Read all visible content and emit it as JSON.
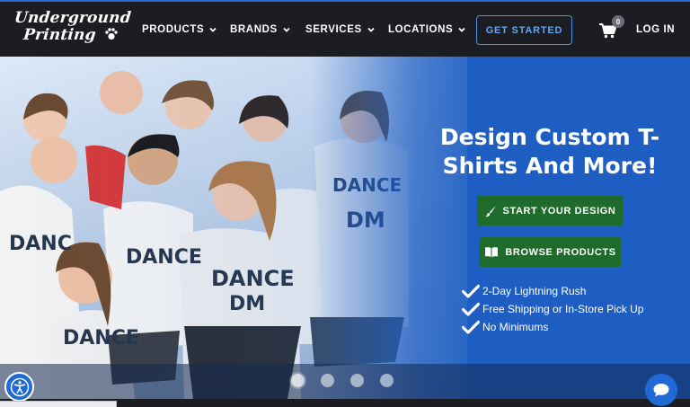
{
  "brand": {
    "name_line1": "Underground",
    "name_line2": "Printing",
    "logo_icon": "paw-icon"
  },
  "nav": {
    "items": [
      {
        "label": "PRODUCTS",
        "icon": "chevron-down-icon"
      },
      {
        "label": "BRANDS",
        "icon": "chevron-down-icon"
      },
      {
        "label": "SERVICES",
        "icon": "chevron-down-icon"
      },
      {
        "label": "LOCATIONS",
        "icon": "chevron-down-icon"
      }
    ],
    "cta_label": "GET STARTED",
    "cart_count": "0",
    "cart_icon": "cart-icon",
    "login_label": "LOG IN"
  },
  "hero": {
    "headline": "Design Custom T-Shirts And More!",
    "photo_description_icon": "group-photo",
    "buttons": [
      {
        "label": "START YOUR DESIGN",
        "icon": "paintbrush-icon"
      },
      {
        "label": "BROWSE PRODUCTS",
        "icon": "book-icon"
      }
    ],
    "features": [
      "2-Day Lightning Rush",
      "Free Shipping or In-Store Pick Up",
      "No Minimums"
    ],
    "carousel": {
      "slide_count": 4,
      "active_index": 0
    }
  },
  "widgets": {
    "accessibility_icon": "accessibility-icon",
    "chat_icon": "chat-icon"
  },
  "colors": {
    "header_bg": "#1b1d22",
    "hero_blue": "#1e5ec3",
    "accent_blue": "#4d8fe0",
    "button_green": "#1e6b2c"
  }
}
